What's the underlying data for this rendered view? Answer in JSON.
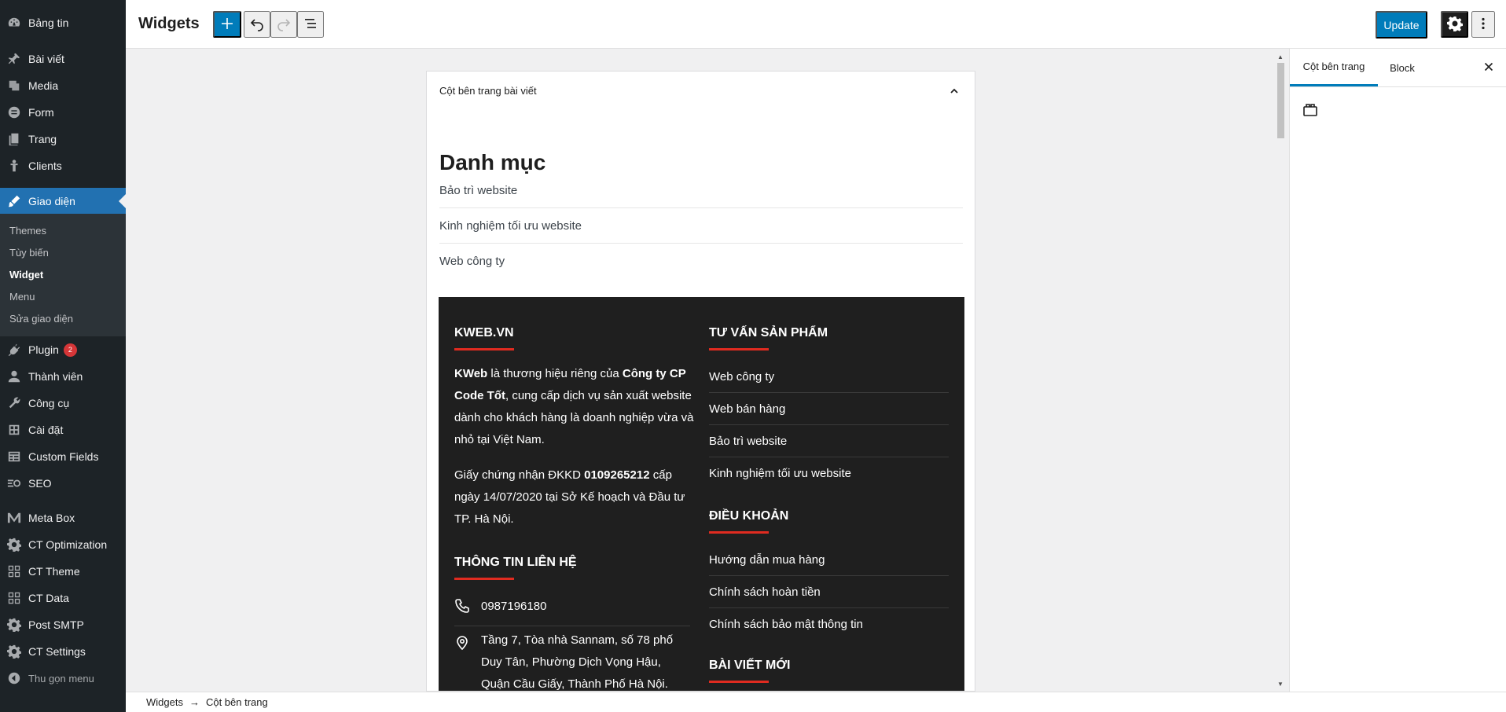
{
  "sidebar": {
    "items": [
      {
        "label": "Bảng tin",
        "icon": "dashboard-icon"
      },
      {
        "label": "Bài viết",
        "icon": "pin-icon"
      },
      {
        "label": "Media",
        "icon": "media-icon"
      },
      {
        "label": "Form",
        "icon": "form-icon"
      },
      {
        "label": "Trang",
        "icon": "page-icon"
      },
      {
        "label": "Clients",
        "icon": "person-icon"
      },
      {
        "label": "Giao diện",
        "icon": "brush-icon"
      },
      {
        "label": "Plugin",
        "icon": "plugin-icon",
        "badge": "2"
      },
      {
        "label": "Thành viên",
        "icon": "user-icon"
      },
      {
        "label": "Công cụ",
        "icon": "wrench-icon"
      },
      {
        "label": "Cài đặt",
        "icon": "settings-icon"
      },
      {
        "label": "Custom Fields",
        "icon": "table-icon"
      },
      {
        "label": "SEO",
        "icon": "seo-icon"
      },
      {
        "label": "Meta Box",
        "icon": "metabox-icon"
      },
      {
        "label": "CT Optimization",
        "icon": "gear-icon"
      },
      {
        "label": "CT Theme",
        "icon": "grid-icon"
      },
      {
        "label": "CT Data",
        "icon": "grid-icon"
      },
      {
        "label": "Post SMTP",
        "icon": "gear-icon"
      },
      {
        "label": "CT Settings",
        "icon": "gear-icon"
      }
    ],
    "submenu": [
      "Themes",
      "Tùy biến",
      "Widget",
      "Menu",
      "Sửa giao diện"
    ],
    "collapse_label": "Thu gọn menu"
  },
  "header": {
    "title": "Widgets",
    "update_label": "Update"
  },
  "widget_area": {
    "title": "Cột bên trang bài viết",
    "categories_heading": "Danh mục",
    "categories": [
      "Bảo trì website",
      "Kinh nghiệm tối ưu website",
      "Web công ty"
    ]
  },
  "footer": {
    "col1_title": "KWEB.VN",
    "about_b1": "KWeb",
    "about_t1": " là thương hiệu riêng của ",
    "about_b2": "Công ty CP Code Tốt",
    "about_t2": ", cung cấp dịch vụ sản xuất website dành cho khách hàng là doanh nghiệp vừa và nhỏ tại Việt Nam.",
    "license_t1": "Giấy chứng nhận ĐKKD ",
    "license_b": "0109265212",
    "license_t2": " cấp ngày 14/07/2020 tại Sở Kế hoạch và Đầu tư TP. Hà Nội.",
    "contact_title": "THÔNG TIN LIÊN HỆ",
    "phone": "0987196180",
    "address": "Tầng 7, Tòa nhà Sannam, số 78 phố Duy Tân, Phường Dịch Vọng Hậu, Quận Cầu Giấy, Thành Phố Hà Nội.",
    "col2_title": "TƯ VẤN SẢN PHẨM",
    "col2_links": [
      "Web công ty",
      "Web bán hàng",
      "Bảo trì website",
      "Kinh nghiệm tối ưu website"
    ],
    "terms_title": "ĐIỀU KHOẢN",
    "terms_links": [
      "Hướng dẫn mua hàng",
      "Chính sách hoàn tiền",
      "Chính sách bảo mật thông tin"
    ],
    "recent_title": "BÀI VIẾT MỚI"
  },
  "settings_panel": {
    "tab_sidebar": "Cột bên trang",
    "tab_block": "Block"
  },
  "breadcrumb": {
    "root": "Widgets",
    "arrow": "→",
    "current": "Cột bên trang"
  }
}
